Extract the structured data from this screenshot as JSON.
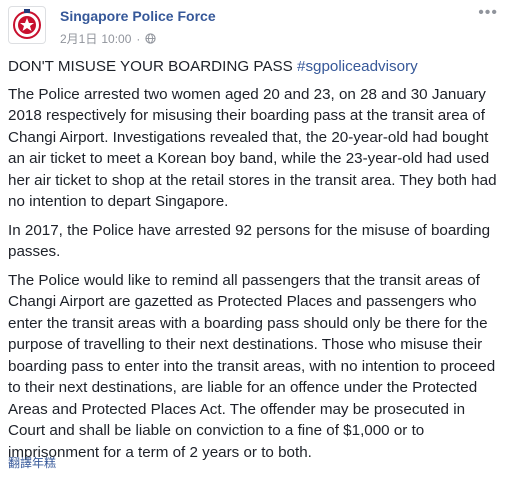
{
  "header": {
    "page_name": "Singapore Police Force",
    "date": "2月1日",
    "time": "10:00",
    "separator": "·",
    "privacy_icon": "globe-icon",
    "more_icon": "more-options-icon",
    "avatar_icon": "police-crest-icon"
  },
  "post": {
    "headline": "DON'T MISUSE YOUR BOARDING PASS",
    "hashtag": "#sgpoliceadvisory",
    "paragraphs": [
      "The Police arrested two women aged 20 and 23, on 28 and 30 January 2018 respectively for misusing their boarding pass at the transit area of Changi Airport. Investigations revealed that, the 20-year-old had bought an air ticket to meet a Korean boy band, while the 23-year-old had used her air ticket to shop at the retail stores in the transit area. They both had no intention to depart Singapore.",
      "In 2017, the Police have arrested 92 persons for the misuse of boarding passes.",
      "The Police would like to remind all passengers that the transit areas of Changi Airport are gazetted as Protected Places and passengers who enter the transit areas with a boarding pass should only be there for the purpose of travelling to their next destinations. Those who misuse their boarding pass to enter into the transit areas, with no intention to proceed to their next destinations, are liable for an offence under the Protected Areas and Protected Places Act. The offender may be prosecuted in Court and shall be liable on conviction to a fine of $1,000 or to imprisonment for a term of 2 years or to both."
    ]
  },
  "footer": {
    "translate_label": "翻譯年糕"
  },
  "colors": {
    "link": "#365899",
    "text": "#1d2129",
    "meta": "#90949c",
    "crest_red": "#c8102e"
  }
}
